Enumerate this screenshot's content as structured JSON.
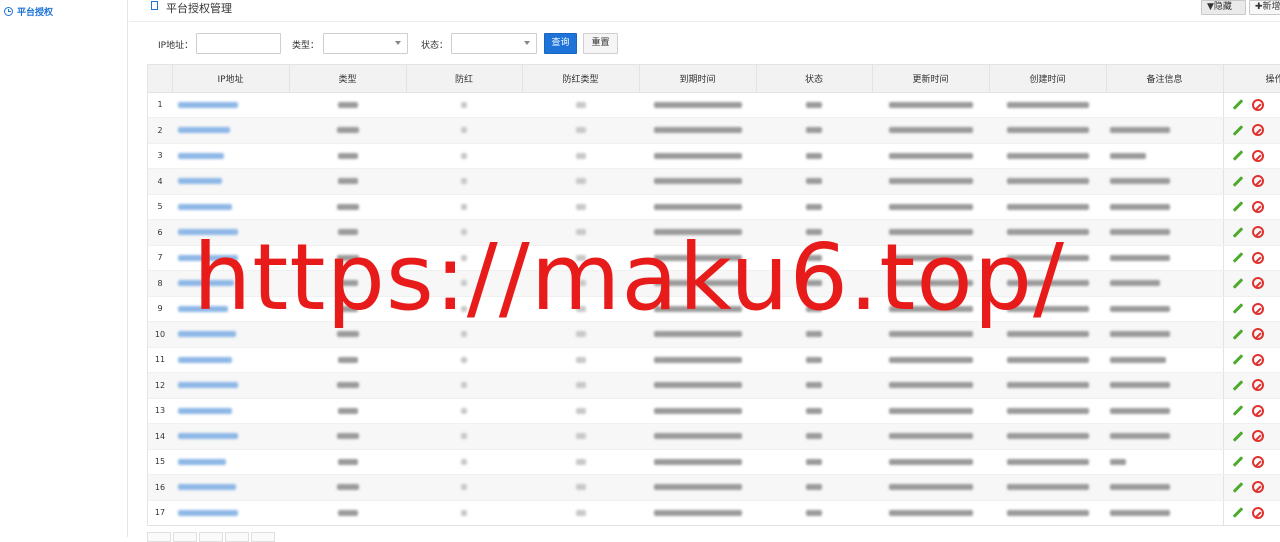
{
  "sidebar": {
    "active_item": "平台授权"
  },
  "header": {
    "title": "平台授权管理",
    "hide_button": "▼隐藏",
    "new_button": "✚新增"
  },
  "filters": {
    "ip_label": "IP地址：",
    "type_label": "类型：",
    "status_label": "状态：",
    "query_button": "查询",
    "reset_button": "重置"
  },
  "table": {
    "columns": [
      "",
      "IP地址",
      "类型",
      "防红",
      "防红类型",
      "到期时间",
      "状态",
      "更新时间",
      "创建时间",
      "备注信息",
      "操作"
    ],
    "row_numbers": [
      "1",
      "2",
      "3",
      "4",
      "5",
      "6",
      "7",
      "8",
      "9",
      "10",
      "11",
      "12",
      "13",
      "14",
      "15",
      "16",
      "17"
    ]
  },
  "watermark": "https://maku6.top/",
  "colors": {
    "accent": "#1e73d8",
    "edit": "#4caa2d",
    "disable": "#e0322f",
    "watermark": "#e81b1b"
  },
  "icons": {
    "sidebar": "clock-icon",
    "edit": "pencil-icon",
    "disable": "ban-icon"
  }
}
